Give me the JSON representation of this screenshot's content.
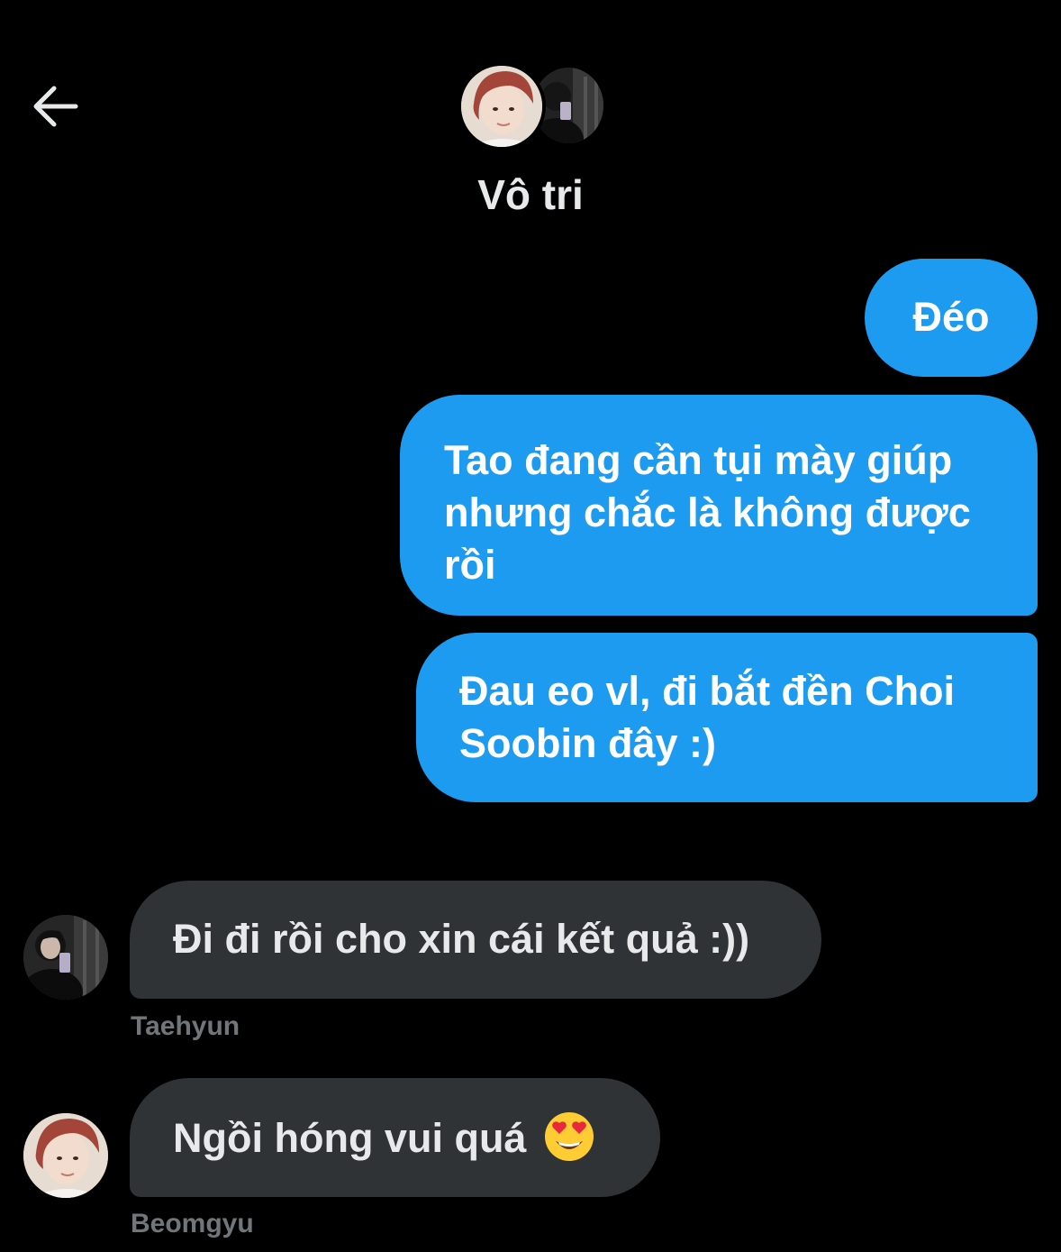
{
  "header": {
    "back_icon": "arrow-left-icon",
    "title": "Vô tri",
    "avatars": [
      "avatar-member-1",
      "avatar-member-2"
    ]
  },
  "colors": {
    "background": "#000000",
    "outgoing_bubble": "#1d9bf0",
    "incoming_bubble": "#2f3336",
    "sender_name": "#71767b"
  },
  "messages": [
    {
      "direction": "outgoing",
      "lines": [
        "Đéo"
      ]
    },
    {
      "direction": "outgoing",
      "lines": [
        "Tao đang cần tụi mày giúp",
        "nhưng chắc là không được",
        "rồi"
      ]
    },
    {
      "direction": "outgoing",
      "lines": [
        "Đau eo vl, đi bắt đền Choi",
        "Soobin đây :)"
      ]
    },
    {
      "direction": "incoming",
      "lines": [
        "Đi đi rồi cho xin cái kết quả :))"
      ],
      "sender": "Taehyun"
    },
    {
      "direction": "incoming",
      "lines": [
        "Ngồi hóng vui quá"
      ],
      "emoji": "heart-eyes-emoji",
      "sender": "Beomgyu"
    }
  ]
}
